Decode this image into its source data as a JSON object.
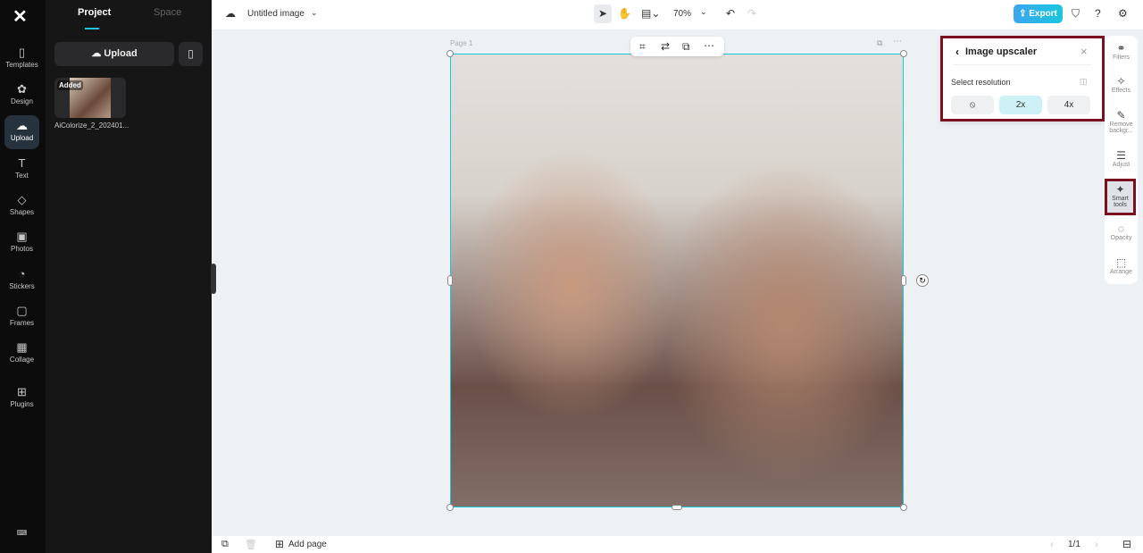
{
  "rail": {
    "items": [
      {
        "label": "Templates",
        "icon": "▯"
      },
      {
        "label": "Design",
        "icon": "✿"
      },
      {
        "label": "Upload",
        "icon": "☁"
      },
      {
        "label": "Text",
        "icon": "T"
      },
      {
        "label": "Shapes",
        "icon": "◇"
      },
      {
        "label": "Photos",
        "icon": "▣"
      },
      {
        "label": "Stickers",
        "icon": "◔"
      },
      {
        "label": "Frames",
        "icon": "▢"
      },
      {
        "label": "Collage",
        "icon": "▦"
      },
      {
        "label": "Plugins",
        "icon": "⊞"
      }
    ]
  },
  "panel": {
    "tabs": [
      "Project",
      "Space"
    ],
    "upload_label": "Upload",
    "asset": {
      "name": "AiColorize_2_202401...",
      "badge": "Added"
    }
  },
  "topbar": {
    "title": "Untitled image",
    "zoom": "70%",
    "export_label": "Export"
  },
  "canvas": {
    "page_label": "Page 1"
  },
  "upscaler": {
    "title": "Image upscaler",
    "section": "Select resolution",
    "options": [
      "⦸",
      "2x",
      "4x"
    ],
    "selected": "2x"
  },
  "tools": [
    {
      "label": "Filters",
      "icon": "⚭"
    },
    {
      "label": "Effects",
      "icon": "✧"
    },
    {
      "label": "Remove backgr...",
      "icon": "✎"
    },
    {
      "label": "Adjust",
      "icon": "☰"
    },
    {
      "label": "Smart tools",
      "icon": "✦"
    },
    {
      "label": "Opacity",
      "icon": "◌"
    },
    {
      "label": "Arrange",
      "icon": "⬚"
    }
  ],
  "bottombar": {
    "add_page": "Add page",
    "page_count": "1/1"
  }
}
